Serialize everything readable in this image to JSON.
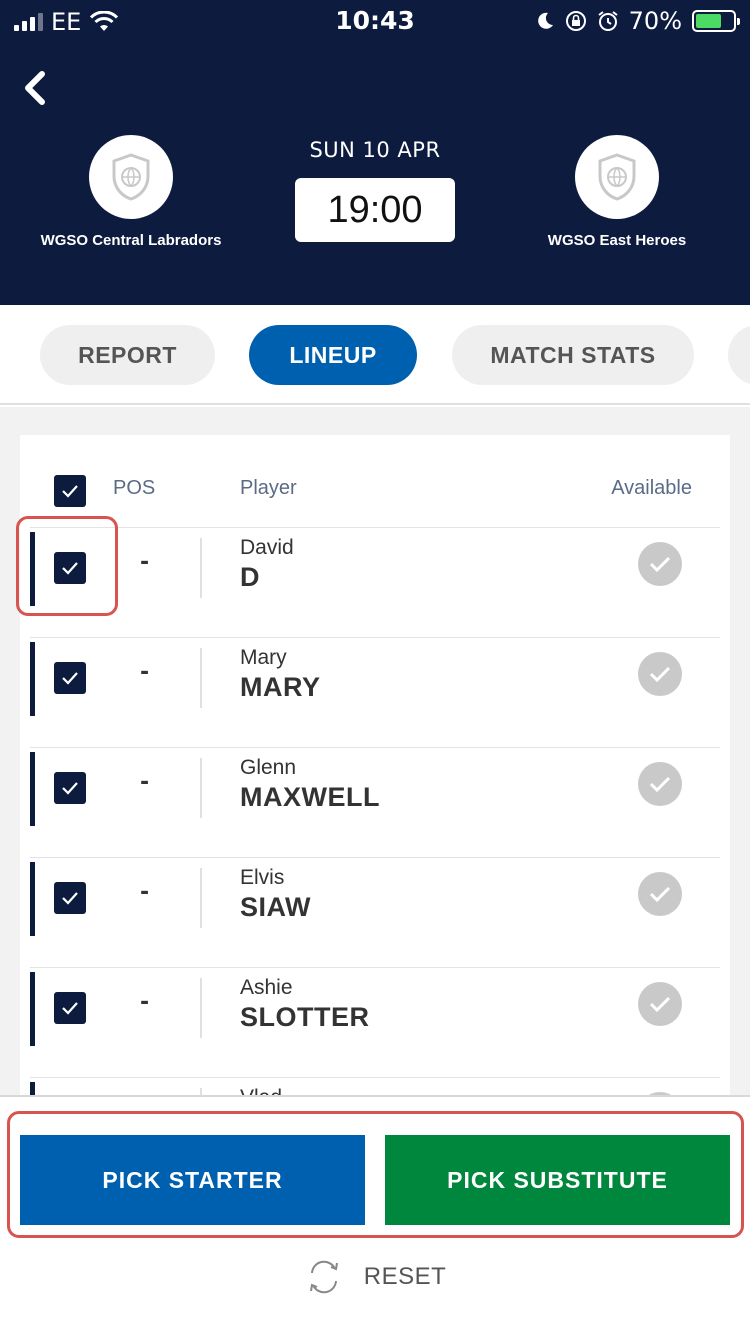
{
  "status_bar": {
    "carrier": "EE",
    "time": "10:43",
    "battery": "70%"
  },
  "match": {
    "date": "SUN 10 APR",
    "time": "19:00",
    "home_team": "WGSO Central Labradors",
    "away_team": "WGSO East Heroes"
  },
  "tabs": [
    {
      "label": "REPORT",
      "active": false
    },
    {
      "label": "LINEUP",
      "active": true
    },
    {
      "label": "MATCH STATS",
      "active": false
    }
  ],
  "list_header": {
    "pos": "POS",
    "player": "Player",
    "available": "Available"
  },
  "players": [
    {
      "first": "David",
      "last": "D",
      "pos": "-",
      "selected": true,
      "available": true
    },
    {
      "first": "Mary",
      "last": "MARY",
      "pos": "-",
      "selected": true,
      "available": true
    },
    {
      "first": "Glenn",
      "last": "MAXWELL",
      "pos": "-",
      "selected": true,
      "available": true
    },
    {
      "first": "Elvis",
      "last": "SIAW",
      "pos": "-",
      "selected": true,
      "available": true
    },
    {
      "first": "Ashie",
      "last": "SLOTTER",
      "pos": "-",
      "selected": true,
      "available": true
    },
    {
      "first": "Vlad",
      "last": "",
      "pos": "-",
      "selected": true,
      "available": true
    }
  ],
  "footer": {
    "pick_starter": "PICK STARTER",
    "pick_substitute": "PICK SUBSTITUTE",
    "reset": "RESET"
  },
  "colors": {
    "navy": "#0d1b3e",
    "blue": "#0060b0",
    "green": "#00873e",
    "highlight": "#d9534f"
  }
}
